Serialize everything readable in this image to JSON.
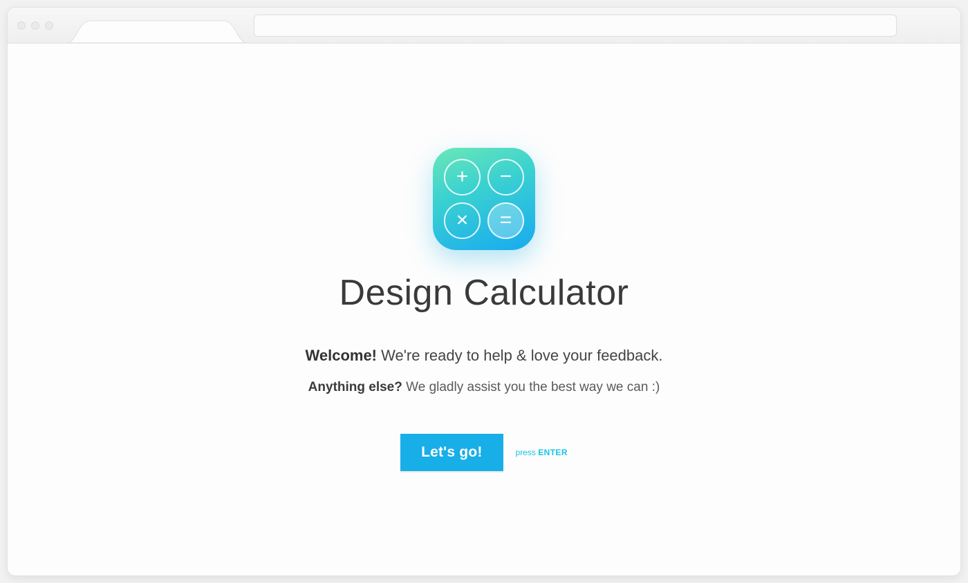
{
  "app": {
    "title": "Design Calculator",
    "welcome_bold": "Welcome!",
    "welcome_rest": " We're ready to help & love your feedback.",
    "subline_bold": "Anything else?",
    "subline_rest": " We gladly assist you the best way we can :)"
  },
  "cta": {
    "button_label": "Let's go!",
    "hint_prefix": "press ",
    "hint_key": "ENTER"
  },
  "icons": {
    "plus": "+",
    "minus": "−",
    "multiply": "×",
    "equals": "="
  },
  "colors": {
    "accent": "#18aee8",
    "gradient_start": "#6be7b6",
    "gradient_end": "#18aaf0"
  }
}
